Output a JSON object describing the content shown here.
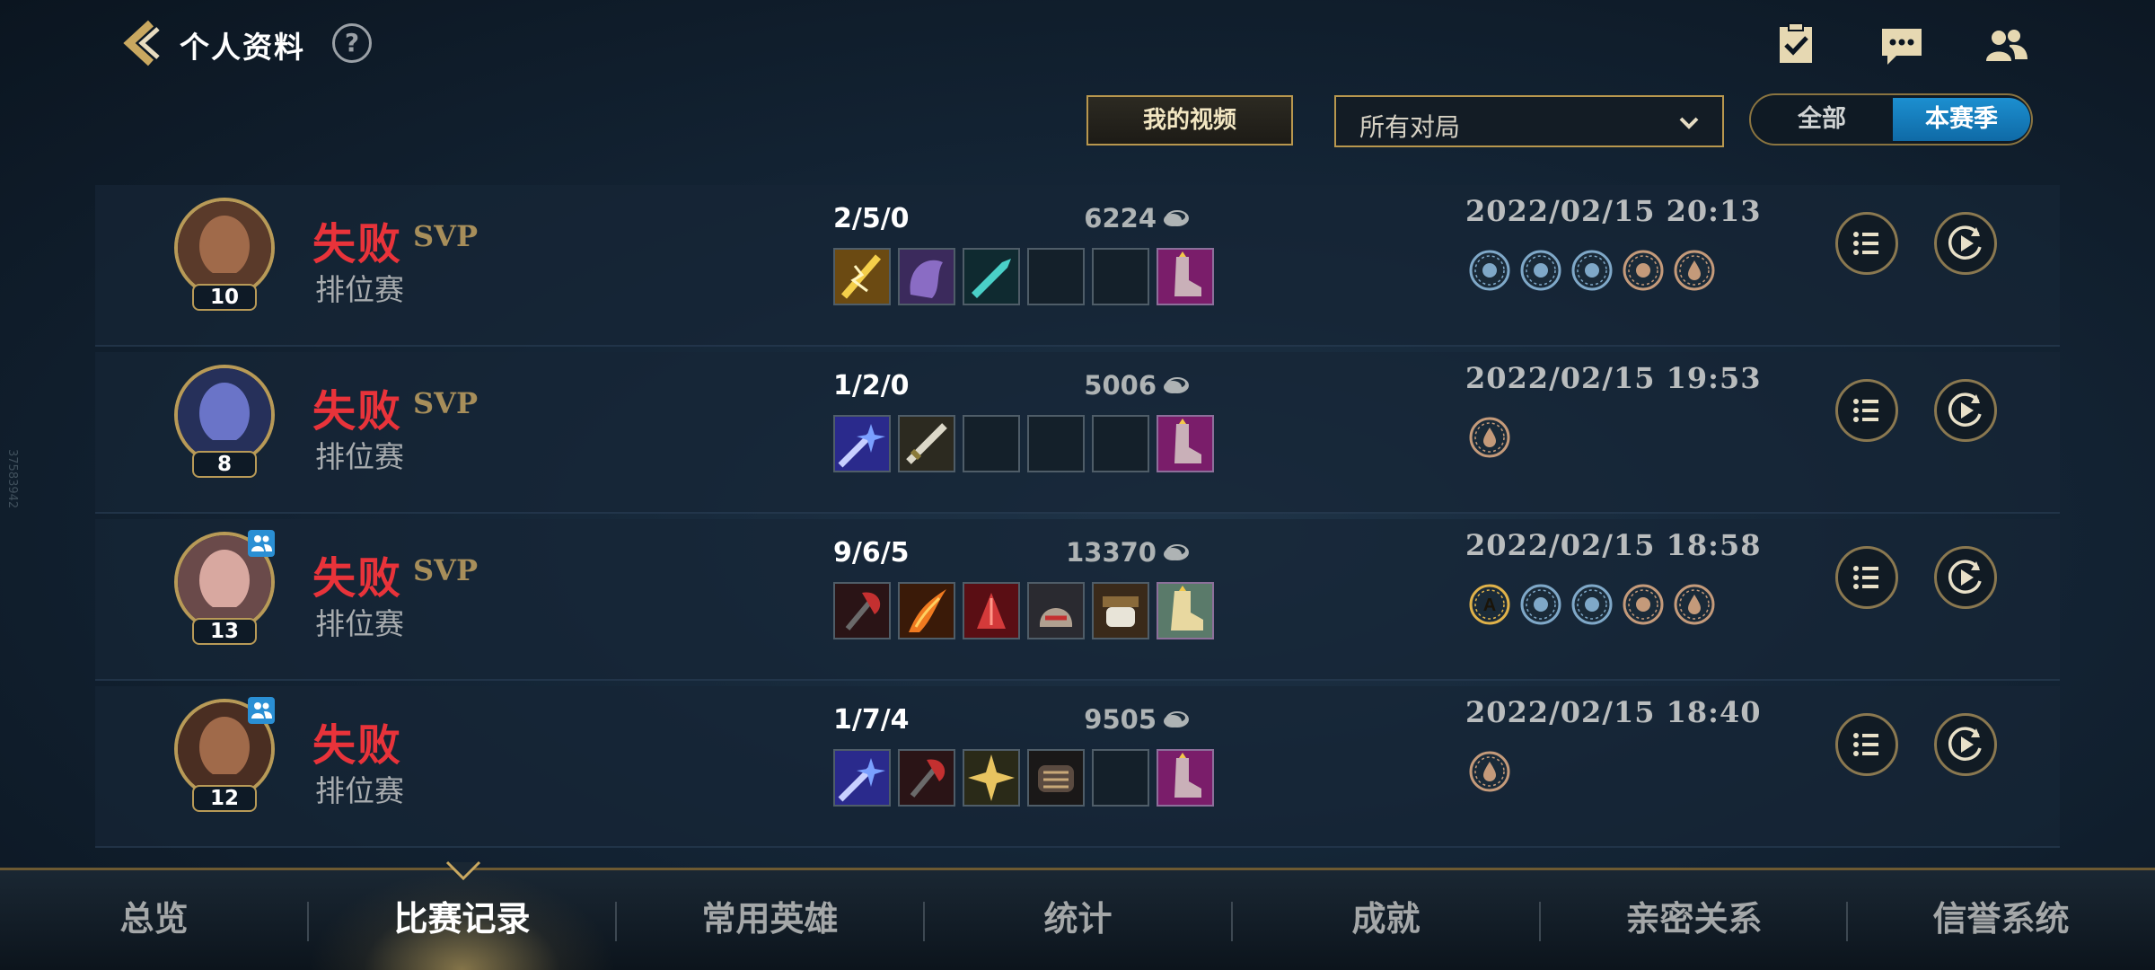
{
  "header": {
    "title": "个人资料",
    "help": "?",
    "icons": [
      "tasks-icon",
      "chat-icon",
      "friends-icon"
    ]
  },
  "filters": {
    "videos_label": "我的视频",
    "dropdown_value": "所有对局",
    "toggle": {
      "all": "全部",
      "season": "本赛季",
      "selected": "本赛季"
    }
  },
  "matches": [
    {
      "level": "10",
      "result": "失败",
      "svp": "SVP",
      "mode": "排位赛",
      "kda": "2/5/0",
      "gold": "6224",
      "date": "2022/02/15 20:13",
      "party": false,
      "items": [
        "lightning-sword-icon",
        "purple-cloak-icon",
        "teal-dagger-icon",
        "empty-slot",
        "empty-slot",
        "boots-icon"
      ],
      "medals": [
        "flag-medal-icon",
        "sword-medal-icon",
        "flame-medal-icon",
        "tree-medal-icon",
        "droplet-medal-icon"
      ]
    },
    {
      "level": "8",
      "result": "失败",
      "svp": "SVP",
      "mode": "排位赛",
      "kda": "1/2/0",
      "gold": "5006",
      "date": "2022/02/15 19:53",
      "party": false,
      "items": [
        "star-blade-icon",
        "long-sword-icon",
        "empty-slot",
        "empty-slot",
        "empty-slot",
        "boots-icon"
      ],
      "medals": [
        "droplet-medal-icon"
      ]
    },
    {
      "level": "13",
      "result": "失败",
      "svp": "SVP",
      "mode": "排位赛",
      "kda": "9/6/5",
      "gold": "13370",
      "date": "2022/02/15 18:58",
      "party": true,
      "items": [
        "red-axe-icon",
        "fire-blade-icon",
        "crimson-claw-icon",
        "warrior-helm-icon",
        "gauntlet-icon",
        "armored-boots-icon"
      ],
      "medals": [
        "gold-a-medal-icon",
        "shield-medal-icon",
        "spiral-medal-icon",
        "tree-medal-icon",
        "droplet-medal-icon"
      ]
    },
    {
      "level": "12",
      "result": "失败",
      "svp": "",
      "mode": "排位赛",
      "kda": "1/7/4",
      "gold": "9505",
      "date": "2022/02/15 18:40",
      "party": true,
      "items": [
        "star-blade-icon",
        "red-axe-icon",
        "gold-mace-icon",
        "dark-gauntlet-icon",
        "empty-slot",
        "boots-icon"
      ],
      "medals": [
        "droplet-medal-icon"
      ]
    }
  ],
  "nav": {
    "items": [
      "总览",
      "比赛记录",
      "常用英雄",
      "统计",
      "成就",
      "亲密关系",
      "信誉系统"
    ],
    "active": "比赛记录"
  },
  "side_id": "37583942",
  "colors": {
    "defeat": "#e8333a",
    "gold_border": "#b8974e",
    "accent_blue": "#1c8fd0"
  }
}
